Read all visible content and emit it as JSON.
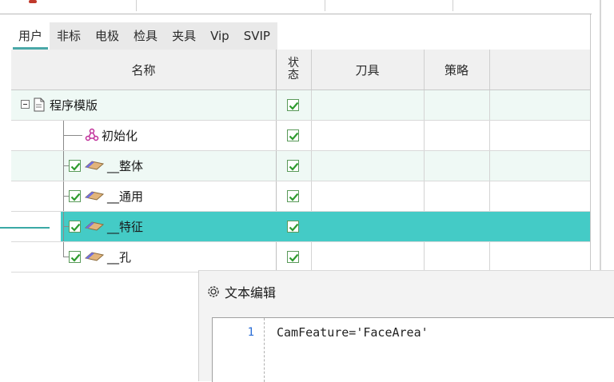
{
  "tabs": [
    "用户",
    "非标",
    "电极",
    "检具",
    "夹具",
    "Vip",
    "SVIP"
  ],
  "columns": {
    "name": "名称",
    "status_line1": "状",
    "status_line2": "态",
    "tool": "刀具",
    "strategy": "策略"
  },
  "rows": [
    {
      "label": "程序模版",
      "status": true,
      "kind": "root"
    },
    {
      "label": "初始化",
      "status": true,
      "kind": "init"
    },
    {
      "label": "__整体",
      "status": true,
      "kind": "item",
      "checked": true
    },
    {
      "label": "__通用",
      "status": true,
      "kind": "item",
      "checked": true
    },
    {
      "label": "__特征",
      "status": true,
      "kind": "item",
      "checked": true,
      "selected": true
    },
    {
      "label": "__孔",
      "status": true,
      "kind": "item",
      "checked": true
    }
  ],
  "dialog": {
    "title": "文本编辑",
    "line_number": "1",
    "code": "CamFeature='FaceArea'"
  },
  "colors": {
    "selected_row": "#44cbc6",
    "alt_row": "#eff9f5",
    "check": "#2e9b2e",
    "active_tab_underline": "#4aa8a8"
  },
  "icons": {
    "root": "document-icon",
    "init": "tree-node-icon",
    "item": "eraser-icon",
    "dialog": "gear-icon"
  }
}
